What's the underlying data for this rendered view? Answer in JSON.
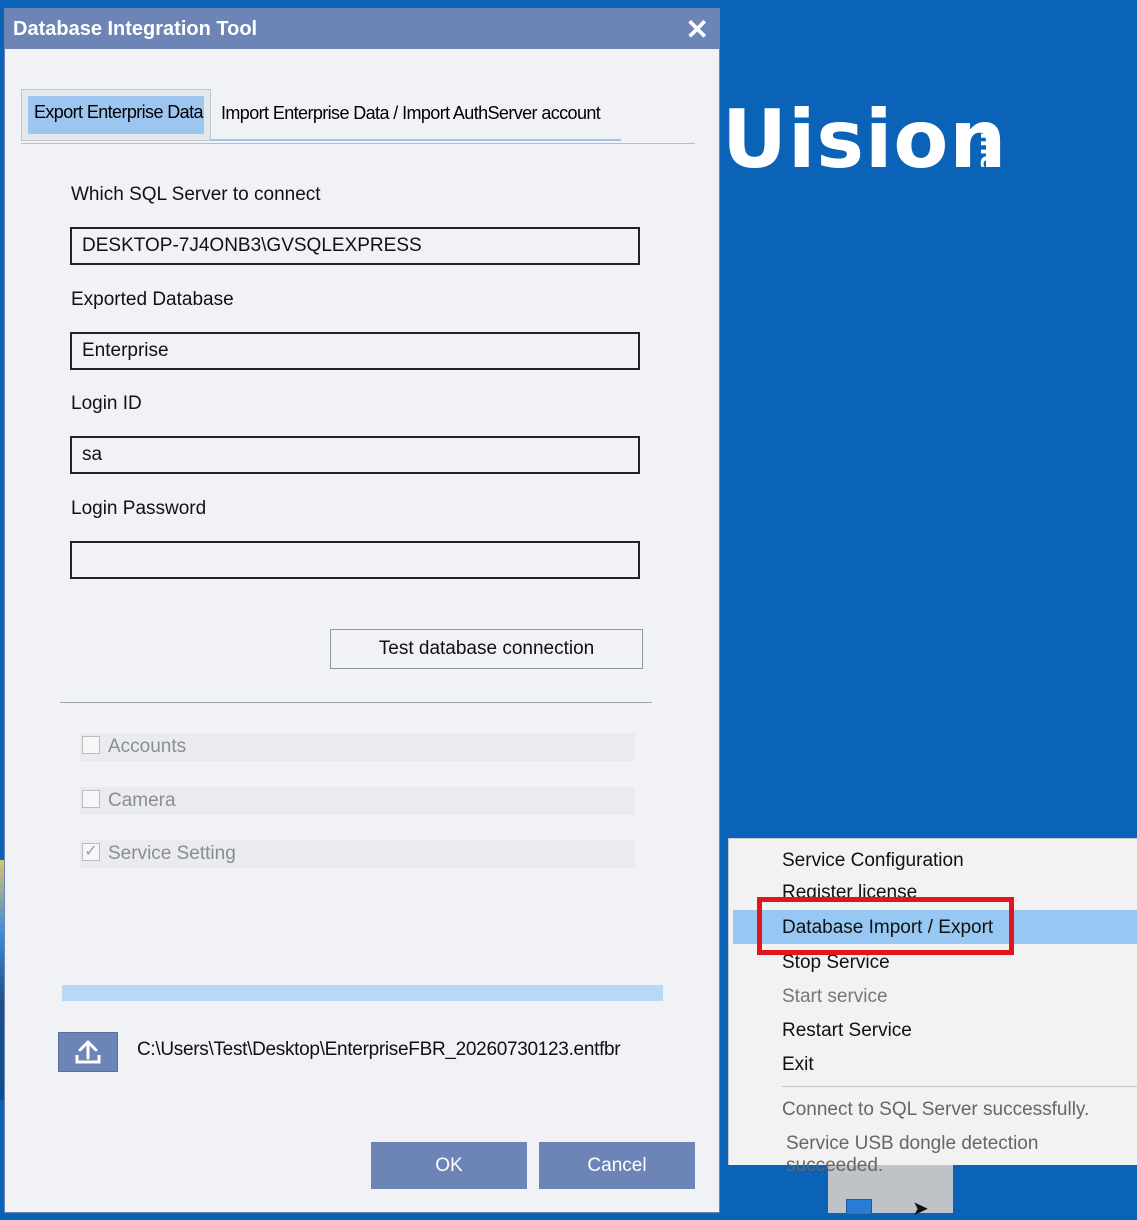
{
  "desktop": {
    "brand": "Uision",
    "brand_suffix": "inc"
  },
  "dialog": {
    "title": "Database Integration Tool",
    "tabs": [
      {
        "label": "Export Enterprise Data",
        "active": true
      },
      {
        "label": "Import Enterprise Data / Import AuthServer account",
        "active": false
      }
    ],
    "fields": {
      "sql_server_label": "Which SQL Server to connect",
      "sql_server_value": "DESKTOP-7J4ONB3\\GVSQLEXPRESS",
      "database_label": "Exported Database",
      "database_value": "Enterprise",
      "login_id_label": "Login ID",
      "login_id_value": "sa",
      "password_label": "Login Password",
      "password_value": ""
    },
    "test_button": "Test database connection",
    "checkboxes": [
      {
        "label": "Accounts",
        "checked": false
      },
      {
        "label": "Camera",
        "checked": false
      },
      {
        "label": "Service Setting",
        "checked": true
      }
    ],
    "export_path": "C:\\Users\\Test\\Desktop\\EnterpriseFBR_20260730123.entfbr",
    "ok_button": "OK",
    "cancel_button": "Cancel"
  },
  "context_menu": {
    "items": [
      {
        "label": "Service Configuration",
        "enabled": true
      },
      {
        "label": "Register license",
        "enabled": true
      },
      {
        "label": "Database Import / Export",
        "enabled": true,
        "highlighted": true
      },
      {
        "label": "Stop Service",
        "enabled": true
      },
      {
        "label": "Start service",
        "enabled": false
      },
      {
        "label": "Restart Service",
        "enabled": true
      },
      {
        "label": "Exit",
        "enabled": true
      }
    ],
    "status": [
      "Connect to SQL Server successfully.",
      "Service USB dongle detection succeeded."
    ]
  },
  "colors": {
    "desktop_blue": "#0a63b6",
    "titlebar": "#6d84b6",
    "tab_active": "#9cc5ef",
    "menu_highlight": "#96c8f3",
    "annotation_red": "#e4141f"
  }
}
